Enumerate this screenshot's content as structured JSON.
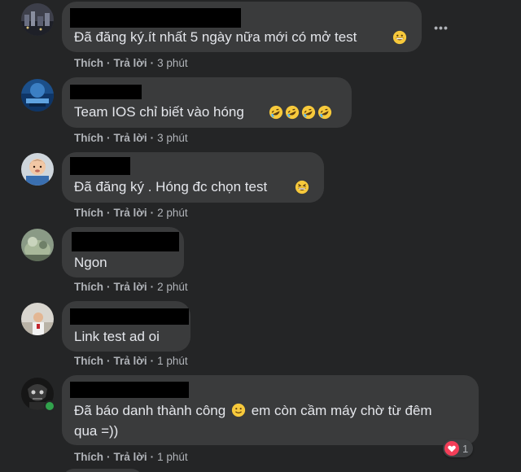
{
  "comments": [
    {
      "text": "Đã đăng ký.ít nhất 5 ngày nữa mới có mở test",
      "like_label": "Thích",
      "reply_label": "Trả lời",
      "time": "3 phút",
      "emoji": "grinning-face-emoji"
    },
    {
      "text": "Team IOS chỉ biết vào hóng",
      "like_label": "Thích",
      "reply_label": "Trả lời",
      "time": "3 phút",
      "emoji": "rolling-on-floor-laughing-emoji"
    },
    {
      "text": "Đã đăng ký . Hóng đc chọn test",
      "like_label": "Thích",
      "reply_label": "Trả lời",
      "time": "2 phút",
      "emoji": "laughing-face-emoji"
    },
    {
      "text": "Ngon",
      "like_label": "Thích",
      "reply_label": "Trả lời",
      "time": "2 phút"
    },
    {
      "text": "Link test ad oi",
      "like_label": "Thích",
      "reply_label": "Trả lời",
      "time": "1 phút"
    },
    {
      "text_part1": "Đã báo danh thành công",
      "text_part2": "em còn cầm máy chờ từ đêm qua =))",
      "like_label": "Thích",
      "reply_label": "Trả lời",
      "time": "1 phút",
      "reaction_count": "1",
      "emoji": "smiling-face-emoji"
    }
  ],
  "separator": "·",
  "colors": {
    "background": "#242526",
    "bubble": "#3a3b3c",
    "text": "#e4e6eb",
    "meta": "#b0b3b8",
    "online": "#31a24c",
    "heart": "#f33e58"
  }
}
